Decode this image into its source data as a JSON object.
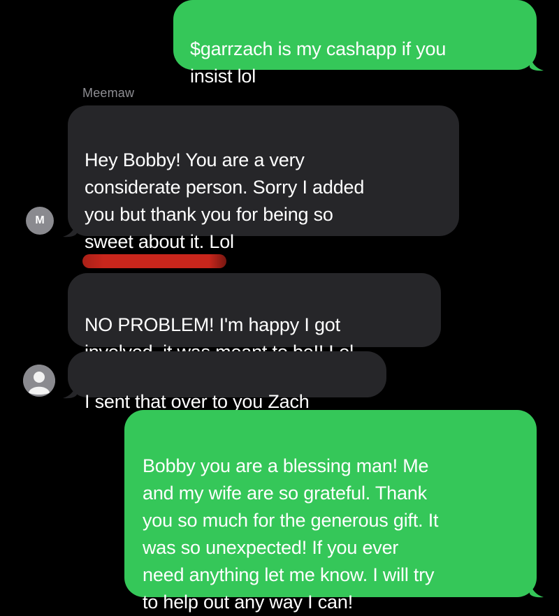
{
  "colors": {
    "background": "#000000",
    "outgoing_bubble": "#35c759",
    "incoming_bubble": "#262629",
    "redaction": "#c8261c",
    "sender_name": "#8e8e93"
  },
  "messages": [
    {
      "direction": "outgoing",
      "text": "$garrzach is my cashapp if you\ninsist lol"
    },
    {
      "direction": "incoming",
      "sender": "Meemaw",
      "text": "Hey Bobby!  You are a very\nconsiderate person. Sorry I added\nyou but thank you for being so\nsweet about it. Lol"
    },
    {
      "direction": "incoming",
      "sender_redacted": true,
      "text": "NO PROBLEM! I'm happy I got\ninvolved, it was meant to be!! Lol"
    },
    {
      "direction": "incoming",
      "text": "I sent that over to you Zach"
    },
    {
      "direction": "outgoing",
      "text": "Bobby you are a blessing man! Me\nand my wife are so grateful. Thank\nyou so much for the generous gift. It\nwas so unexpected! If you ever\nneed anything let me know. I will try\nto help out any way I can!"
    }
  ],
  "avatars": [
    {
      "initial": "M",
      "icon": "monogram-avatar"
    },
    {
      "icon": "person-silhouette-icon"
    }
  ]
}
